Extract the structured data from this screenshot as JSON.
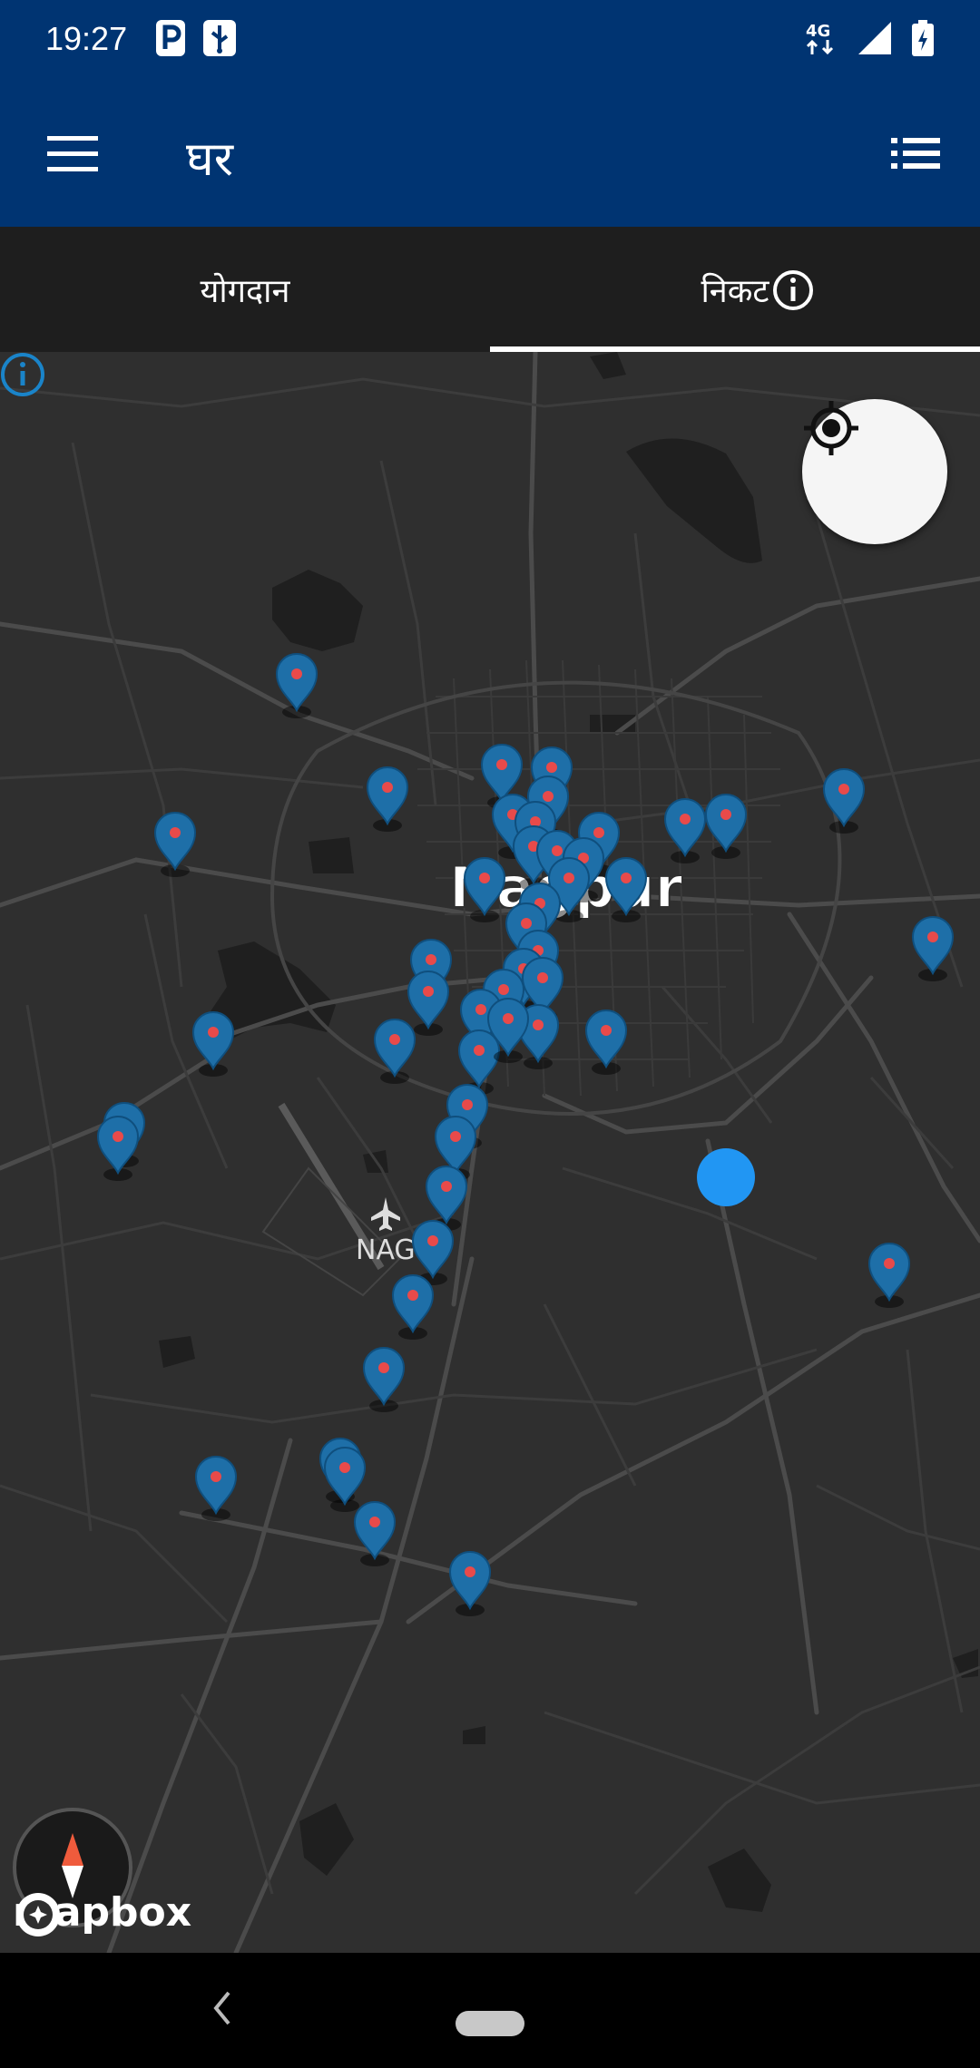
{
  "status_bar": {
    "time": "19:27",
    "network": "4G"
  },
  "app_bar": {
    "title": "घर"
  },
  "tabs": [
    {
      "label": "योगदान",
      "selected": false
    },
    {
      "label": "निकट",
      "selected": true
    }
  ],
  "map": {
    "city_label": "Nagpur",
    "airport_label": "NAG",
    "attribution": "mapbox",
    "colors": {
      "background": "#2f2f2f",
      "pin": "#1e6fa8",
      "pin_dot": "#e84a4a",
      "user_location": "#2196f3"
    }
  },
  "icons": {
    "menu": "hamburger-menu-icon",
    "list": "list-view-icon",
    "info": "info-circle-icon",
    "locate": "my-location-icon",
    "compass": "compass-icon",
    "back": "back-chevron-icon"
  },
  "colors": {
    "primary": "#003472",
    "tab_bar": "#1e1e1e",
    "nav_bar": "#000000"
  }
}
